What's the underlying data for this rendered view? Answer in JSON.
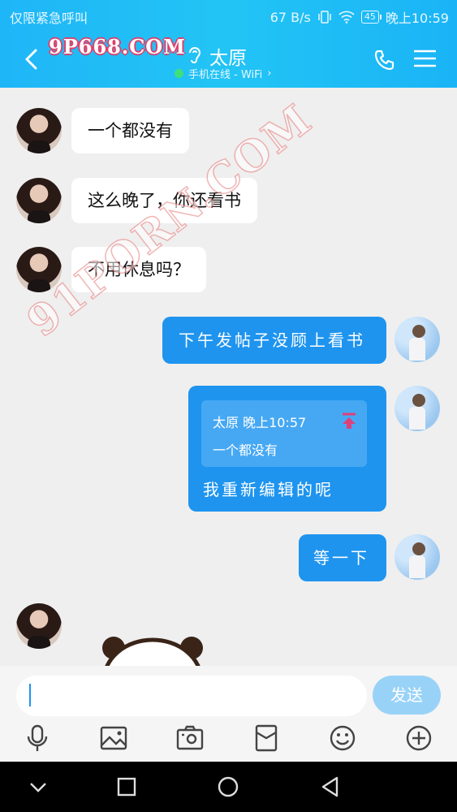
{
  "status_bar": {
    "left_text": "仅限紧急呼叫",
    "speed": "67 B/s",
    "battery": "45",
    "time": "晚上10:59"
  },
  "header": {
    "watermark": "9P668.COM",
    "contact_name": "太原",
    "online_status": "手机在线 - WiFi",
    "status_chevron": "›"
  },
  "watermark_diagonal": "91PORN.COM",
  "messages": [
    {
      "side": "left",
      "text": "一个都没有"
    },
    {
      "side": "left",
      "text": "这么晚了，你还看书"
    },
    {
      "side": "left",
      "text": "不用休息吗？"
    },
    {
      "side": "right",
      "text": "下午发帖子没顾上看书"
    },
    {
      "side": "right",
      "quote_header": "太原 晚上10:57",
      "quote_text": "一个都没有",
      "text": "我重新编辑的呢"
    },
    {
      "side": "right",
      "text": "等一下"
    }
  ],
  "input": {
    "placeholder": "",
    "send_label": "发送"
  },
  "toolbar_icons": [
    "mic-icon",
    "image-icon",
    "camera-icon",
    "red-packet-icon",
    "emoji-icon",
    "plus-icon"
  ],
  "nav_icons": [
    "nav-down-icon",
    "recent-apps-icon",
    "home-icon",
    "back-triangle-icon"
  ],
  "colors": {
    "accent": "#1e94ef",
    "header": "#22c4f5",
    "send_disabled": "#99d2f7",
    "online": "#3fe07a"
  }
}
